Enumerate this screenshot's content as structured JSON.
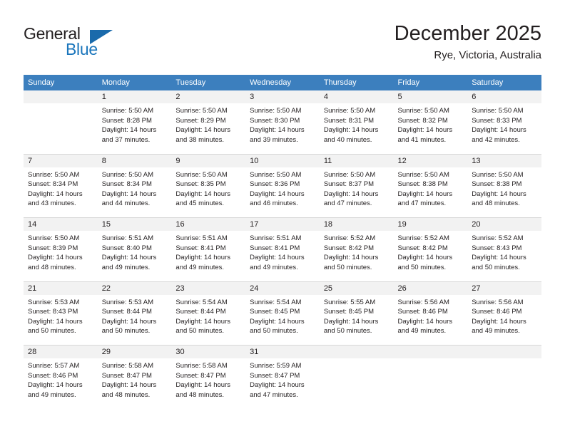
{
  "brand": {
    "name_part1": "General",
    "name_part2": "Blue"
  },
  "header": {
    "month_title": "December 2025",
    "location": "Rye, Victoria, Australia"
  },
  "calendar": {
    "weekday_headers": [
      "Sunday",
      "Monday",
      "Tuesday",
      "Wednesday",
      "Thursday",
      "Friday",
      "Saturday"
    ],
    "accent_color": "#3c7fbe",
    "daynum_bg": "#f2f2f2",
    "weeks": [
      [
        {
          "day": "",
          "sunrise": "",
          "sunset": "",
          "daylight_line1": "",
          "daylight_line2": ""
        },
        {
          "day": "1",
          "sunrise": "Sunrise: 5:50 AM",
          "sunset": "Sunset: 8:28 PM",
          "daylight_line1": "Daylight: 14 hours",
          "daylight_line2": "and 37 minutes."
        },
        {
          "day": "2",
          "sunrise": "Sunrise: 5:50 AM",
          "sunset": "Sunset: 8:29 PM",
          "daylight_line1": "Daylight: 14 hours",
          "daylight_line2": "and 38 minutes."
        },
        {
          "day": "3",
          "sunrise": "Sunrise: 5:50 AM",
          "sunset": "Sunset: 8:30 PM",
          "daylight_line1": "Daylight: 14 hours",
          "daylight_line2": "and 39 minutes."
        },
        {
          "day": "4",
          "sunrise": "Sunrise: 5:50 AM",
          "sunset": "Sunset: 8:31 PM",
          "daylight_line1": "Daylight: 14 hours",
          "daylight_line2": "and 40 minutes."
        },
        {
          "day": "5",
          "sunrise": "Sunrise: 5:50 AM",
          "sunset": "Sunset: 8:32 PM",
          "daylight_line1": "Daylight: 14 hours",
          "daylight_line2": "and 41 minutes."
        },
        {
          "day": "6",
          "sunrise": "Sunrise: 5:50 AM",
          "sunset": "Sunset: 8:33 PM",
          "daylight_line1": "Daylight: 14 hours",
          "daylight_line2": "and 42 minutes."
        }
      ],
      [
        {
          "day": "7",
          "sunrise": "Sunrise: 5:50 AM",
          "sunset": "Sunset: 8:34 PM",
          "daylight_line1": "Daylight: 14 hours",
          "daylight_line2": "and 43 minutes."
        },
        {
          "day": "8",
          "sunrise": "Sunrise: 5:50 AM",
          "sunset": "Sunset: 8:34 PM",
          "daylight_line1": "Daylight: 14 hours",
          "daylight_line2": "and 44 minutes."
        },
        {
          "day": "9",
          "sunrise": "Sunrise: 5:50 AM",
          "sunset": "Sunset: 8:35 PM",
          "daylight_line1": "Daylight: 14 hours",
          "daylight_line2": "and 45 minutes."
        },
        {
          "day": "10",
          "sunrise": "Sunrise: 5:50 AM",
          "sunset": "Sunset: 8:36 PM",
          "daylight_line1": "Daylight: 14 hours",
          "daylight_line2": "and 46 minutes."
        },
        {
          "day": "11",
          "sunrise": "Sunrise: 5:50 AM",
          "sunset": "Sunset: 8:37 PM",
          "daylight_line1": "Daylight: 14 hours",
          "daylight_line2": "and 47 minutes."
        },
        {
          "day": "12",
          "sunrise": "Sunrise: 5:50 AM",
          "sunset": "Sunset: 8:38 PM",
          "daylight_line1": "Daylight: 14 hours",
          "daylight_line2": "and 47 minutes."
        },
        {
          "day": "13",
          "sunrise": "Sunrise: 5:50 AM",
          "sunset": "Sunset: 8:38 PM",
          "daylight_line1": "Daylight: 14 hours",
          "daylight_line2": "and 48 minutes."
        }
      ],
      [
        {
          "day": "14",
          "sunrise": "Sunrise: 5:50 AM",
          "sunset": "Sunset: 8:39 PM",
          "daylight_line1": "Daylight: 14 hours",
          "daylight_line2": "and 48 minutes."
        },
        {
          "day": "15",
          "sunrise": "Sunrise: 5:51 AM",
          "sunset": "Sunset: 8:40 PM",
          "daylight_line1": "Daylight: 14 hours",
          "daylight_line2": "and 49 minutes."
        },
        {
          "day": "16",
          "sunrise": "Sunrise: 5:51 AM",
          "sunset": "Sunset: 8:41 PM",
          "daylight_line1": "Daylight: 14 hours",
          "daylight_line2": "and 49 minutes."
        },
        {
          "day": "17",
          "sunrise": "Sunrise: 5:51 AM",
          "sunset": "Sunset: 8:41 PM",
          "daylight_line1": "Daylight: 14 hours",
          "daylight_line2": "and 49 minutes."
        },
        {
          "day": "18",
          "sunrise": "Sunrise: 5:52 AM",
          "sunset": "Sunset: 8:42 PM",
          "daylight_line1": "Daylight: 14 hours",
          "daylight_line2": "and 50 minutes."
        },
        {
          "day": "19",
          "sunrise": "Sunrise: 5:52 AM",
          "sunset": "Sunset: 8:42 PM",
          "daylight_line1": "Daylight: 14 hours",
          "daylight_line2": "and 50 minutes."
        },
        {
          "day": "20",
          "sunrise": "Sunrise: 5:52 AM",
          "sunset": "Sunset: 8:43 PM",
          "daylight_line1": "Daylight: 14 hours",
          "daylight_line2": "and 50 minutes."
        }
      ],
      [
        {
          "day": "21",
          "sunrise": "Sunrise: 5:53 AM",
          "sunset": "Sunset: 8:43 PM",
          "daylight_line1": "Daylight: 14 hours",
          "daylight_line2": "and 50 minutes."
        },
        {
          "day": "22",
          "sunrise": "Sunrise: 5:53 AM",
          "sunset": "Sunset: 8:44 PM",
          "daylight_line1": "Daylight: 14 hours",
          "daylight_line2": "and 50 minutes."
        },
        {
          "day": "23",
          "sunrise": "Sunrise: 5:54 AM",
          "sunset": "Sunset: 8:44 PM",
          "daylight_line1": "Daylight: 14 hours",
          "daylight_line2": "and 50 minutes."
        },
        {
          "day": "24",
          "sunrise": "Sunrise: 5:54 AM",
          "sunset": "Sunset: 8:45 PM",
          "daylight_line1": "Daylight: 14 hours",
          "daylight_line2": "and 50 minutes."
        },
        {
          "day": "25",
          "sunrise": "Sunrise: 5:55 AM",
          "sunset": "Sunset: 8:45 PM",
          "daylight_line1": "Daylight: 14 hours",
          "daylight_line2": "and 50 minutes."
        },
        {
          "day": "26",
          "sunrise": "Sunrise: 5:56 AM",
          "sunset": "Sunset: 8:46 PM",
          "daylight_line1": "Daylight: 14 hours",
          "daylight_line2": "and 49 minutes."
        },
        {
          "day": "27",
          "sunrise": "Sunrise: 5:56 AM",
          "sunset": "Sunset: 8:46 PM",
          "daylight_line1": "Daylight: 14 hours",
          "daylight_line2": "and 49 minutes."
        }
      ],
      [
        {
          "day": "28",
          "sunrise": "Sunrise: 5:57 AM",
          "sunset": "Sunset: 8:46 PM",
          "daylight_line1": "Daylight: 14 hours",
          "daylight_line2": "and 49 minutes."
        },
        {
          "day": "29",
          "sunrise": "Sunrise: 5:58 AM",
          "sunset": "Sunset: 8:47 PM",
          "daylight_line1": "Daylight: 14 hours",
          "daylight_line2": "and 48 minutes."
        },
        {
          "day": "30",
          "sunrise": "Sunrise: 5:58 AM",
          "sunset": "Sunset: 8:47 PM",
          "daylight_line1": "Daylight: 14 hours",
          "daylight_line2": "and 48 minutes."
        },
        {
          "day": "31",
          "sunrise": "Sunrise: 5:59 AM",
          "sunset": "Sunset: 8:47 PM",
          "daylight_line1": "Daylight: 14 hours",
          "daylight_line2": "and 47 minutes."
        },
        {
          "day": "",
          "sunrise": "",
          "sunset": "",
          "daylight_line1": "",
          "daylight_line2": ""
        },
        {
          "day": "",
          "sunrise": "",
          "sunset": "",
          "daylight_line1": "",
          "daylight_line2": ""
        },
        {
          "day": "",
          "sunrise": "",
          "sunset": "",
          "daylight_line1": "",
          "daylight_line2": ""
        }
      ]
    ]
  }
}
